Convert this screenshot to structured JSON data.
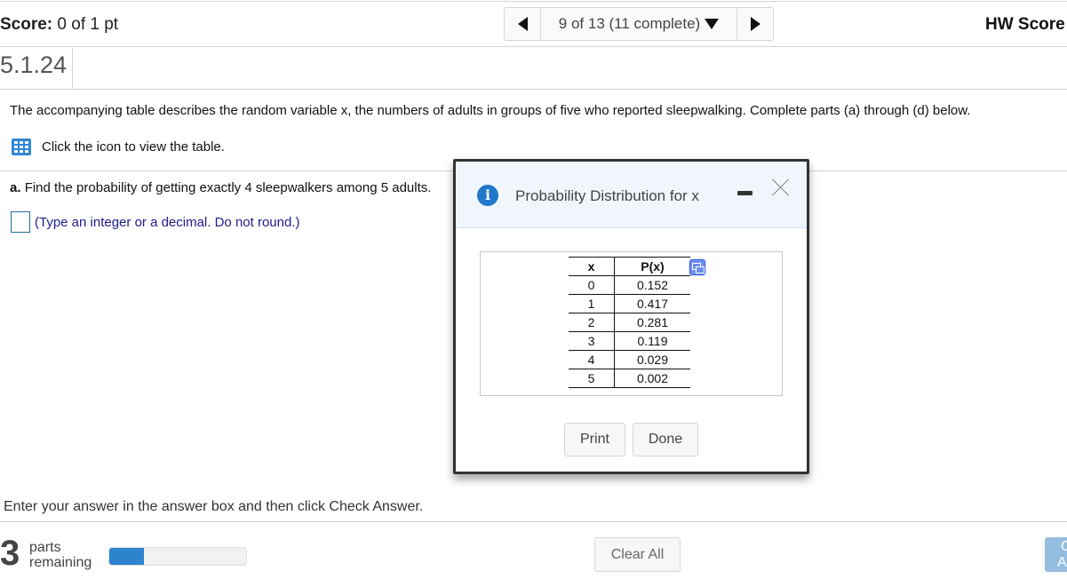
{
  "header": {
    "score_label": "Score:",
    "score_value": "0 of 1 pt",
    "nav_position": "9 of 13 (11 complete)",
    "hw_score_label": "HW Score"
  },
  "question": {
    "number": "5.1.24",
    "intro": "The accompanying table describes the random variable x, the numbers of adults in groups of five who reported sleepwalking. Complete parts (a) through (d) below.",
    "table_link": "Click the icon to view the table.",
    "part_a_label": "a.",
    "part_a_text": "Find the probability of getting exactly 4 sleepwalkers among 5 adults.",
    "answer_value": "",
    "answer_hint": "(Type an integer or a decimal. Do not round.)",
    "instruction": "Enter your answer in the answer box and then click Check Answer."
  },
  "modal": {
    "title": "Probability Distribution for x",
    "table": {
      "headers": [
        "x",
        "P(x)"
      ],
      "rows": [
        [
          "0",
          "0.152"
        ],
        [
          "1",
          "0.417"
        ],
        [
          "2",
          "0.281"
        ],
        [
          "3",
          "0.119"
        ],
        [
          "4",
          "0.029"
        ],
        [
          "5",
          "0.002"
        ]
      ]
    },
    "print_label": "Print",
    "done_label": "Done"
  },
  "footer": {
    "parts_remaining_count": "3",
    "parts_label_1": "parts",
    "parts_label_2": "remaining",
    "progress_fraction": 0.25,
    "progress_color": "#2c84cc",
    "clear_all_label": "Clear All",
    "check_answer_label": "Check Answer"
  }
}
